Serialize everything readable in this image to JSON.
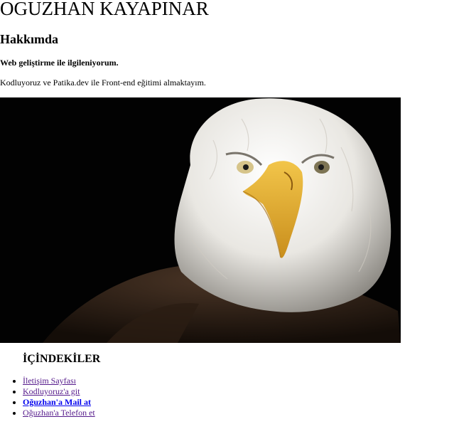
{
  "header": {
    "name": "OGUZHAN KAYAPINAR"
  },
  "about": {
    "heading": "Hakkımda",
    "tagline": "Web geliştirme ile ilgileniyorum.",
    "paragraph": "Kodluyoruz ve Patika.dev ile Front-end eğitimi almaktayım."
  },
  "photo": {
    "subject": "bald eagle portrait",
    "background": "#020202"
  },
  "toc": {
    "title": "İÇİNDEKİLER",
    "items": [
      {
        "label": "İletişim Sayfası"
      },
      {
        "label": "Kodluyoruz'a git"
      },
      {
        "label": "Oğuzhan'a Mail at"
      },
      {
        "label": "Oğuzhan'a Telefon et"
      }
    ]
  },
  "colors": {
    "link_visited": "#551a8b",
    "link": "#0000ee",
    "text": "#000000"
  }
}
